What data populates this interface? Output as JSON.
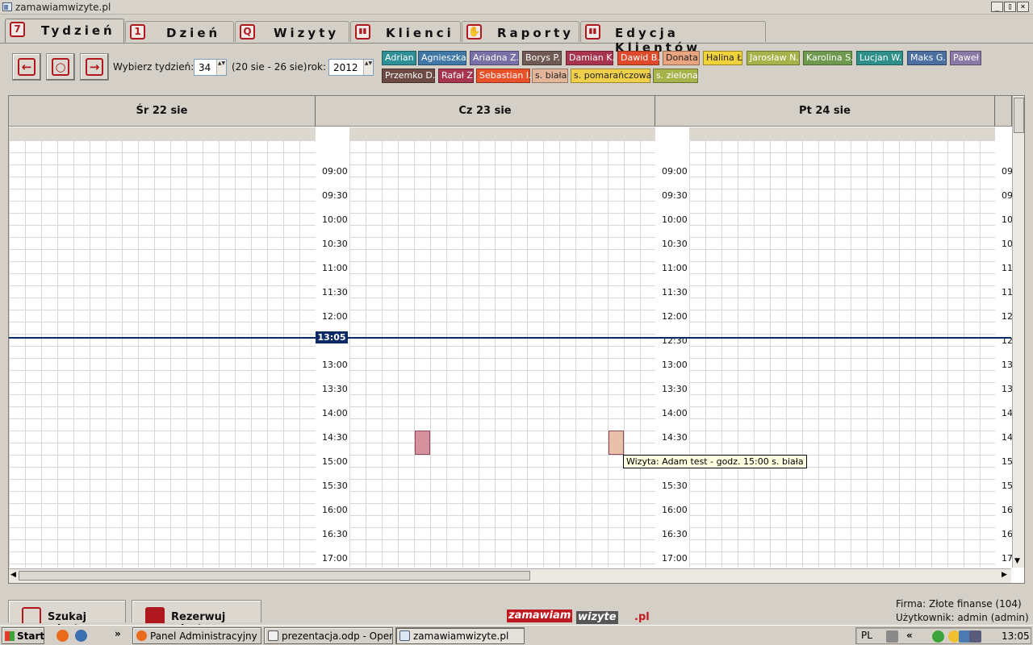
{
  "window": {
    "title": "zamawiamwizyte.pl",
    "btn_min": "_",
    "btn_max": "▯",
    "btn_close": "×"
  },
  "tabs": [
    {
      "label": "Tydzień",
      "icon": "7"
    },
    {
      "label": "Dzień",
      "icon": "1"
    },
    {
      "label": "Wizyty",
      "icon": "Q"
    },
    {
      "label": "Klienci",
      "icon": "▮▮"
    },
    {
      "label": "Raporty",
      "icon": "✋"
    },
    {
      "label": "Edycja Klientów",
      "icon": "▮▮"
    }
  ],
  "controls": {
    "prev_glyph": "←",
    "today_glyph": "○",
    "next_glyph": "→",
    "week_label": "Wybierz tydzień:",
    "week_value": "34",
    "week_range": "(20 sie - 26 sie)",
    "year_label": "rok:",
    "year_value": "2012",
    "spin_glyph": "▲▼"
  },
  "legend": [
    {
      "name": "Adrian",
      "color": "#2f8f97",
      "text": "#ffffff"
    },
    {
      "name": "Agnieszka",
      "color": "#3f78a7",
      "text": "#ffffff"
    },
    {
      "name": "Ariadna Z.",
      "color": "#7a6fa7",
      "text": "#ffffff"
    },
    {
      "name": "Borys P.",
      "color": "#705a56",
      "text": "#ffffff"
    },
    {
      "name": "Damian K.",
      "color": "#a83450",
      "text": "#ffffff"
    },
    {
      "name": "Dawid B.",
      "color": "#e04a2a",
      "text": "#ffffff"
    },
    {
      "name": "Donata",
      "color": "#e9a57f",
      "text": "#222222"
    },
    {
      "name": "Halina Ł",
      "color": "#f2d23a",
      "text": "#222222"
    },
    {
      "name": "Jarosław N.",
      "color": "#a7b24a",
      "text": "#ffffff"
    },
    {
      "name": "Karolina S.",
      "color": "#6d9a4f",
      "text": "#ffffff"
    },
    {
      "name": "Lucjan W.",
      "color": "#2f8f8a",
      "text": "#ffffff"
    },
    {
      "name": "Maks G.",
      "color": "#4a6fa0",
      "text": "#ffffff"
    },
    {
      "name": "Paweł",
      "color": "#8a78a7",
      "text": "#ffffff"
    },
    {
      "name": "Przemko D.",
      "color": "#6e4a44",
      "text": "#ffffff"
    },
    {
      "name": "Rafał Z",
      "color": "#a83450",
      "text": "#ffffff"
    },
    {
      "name": "Sebastian I.",
      "color": "#e8512a",
      "text": "#ffffff"
    },
    {
      "name": "s. biała",
      "color": "#e3b69a",
      "text": "#222222"
    },
    {
      "name": "s. pomarańczowa",
      "color": "#f0d04a",
      "text": "#222222"
    },
    {
      "name": "s. zielona",
      "color": "#a7b24a",
      "text": "#ffffff"
    }
  ],
  "calendar": {
    "days": [
      "Śr 22 sie",
      "Cz 23 sie",
      "Pt 24 sie"
    ],
    "times": [
      "09:00",
      "09:30",
      "10:00",
      "10:30",
      "11:00",
      "11:30",
      "12:00",
      "12:30",
      "13:00",
      "13:30",
      "14:00",
      "14:30",
      "15:00",
      "15:30",
      "16:00",
      "16:30",
      "17:00",
      "17:30"
    ],
    "partial_times": [
      "09",
      "09",
      "10",
      "10",
      "11",
      "11",
      "12",
      "12",
      "13",
      "13",
      "14",
      "14",
      "15",
      "15",
      "16",
      "16",
      "17",
      "17"
    ],
    "now_time": "13:05",
    "visits": [
      {
        "time": "15:00",
        "color": "#d6909e"
      },
      {
        "time": "15:00",
        "color": "#e9c1ab"
      }
    ],
    "tooltip": "Wizyta: Adam test - godz. 15:00 s. biała"
  },
  "bottom": {
    "search_btn": "Szukaj wizyty",
    "book_btn": "Rezerwuj wizytę",
    "logo_part1": "zamawiam",
    "logo_part2": "wizyte",
    "logo_part3": ".pl",
    "firm": "Firma: Złote finanse (104)",
    "user": "Użytkownik: admin (admin)"
  },
  "taskbar": {
    "start": "Start",
    "chevron": "»",
    "items": [
      "Panel Administracyjny - ...",
      "prezentacja.odp - Open...",
      "zamawiamwizyte.pl"
    ],
    "lang": "PL",
    "tray_chevron": "«",
    "clock": "13:05"
  }
}
